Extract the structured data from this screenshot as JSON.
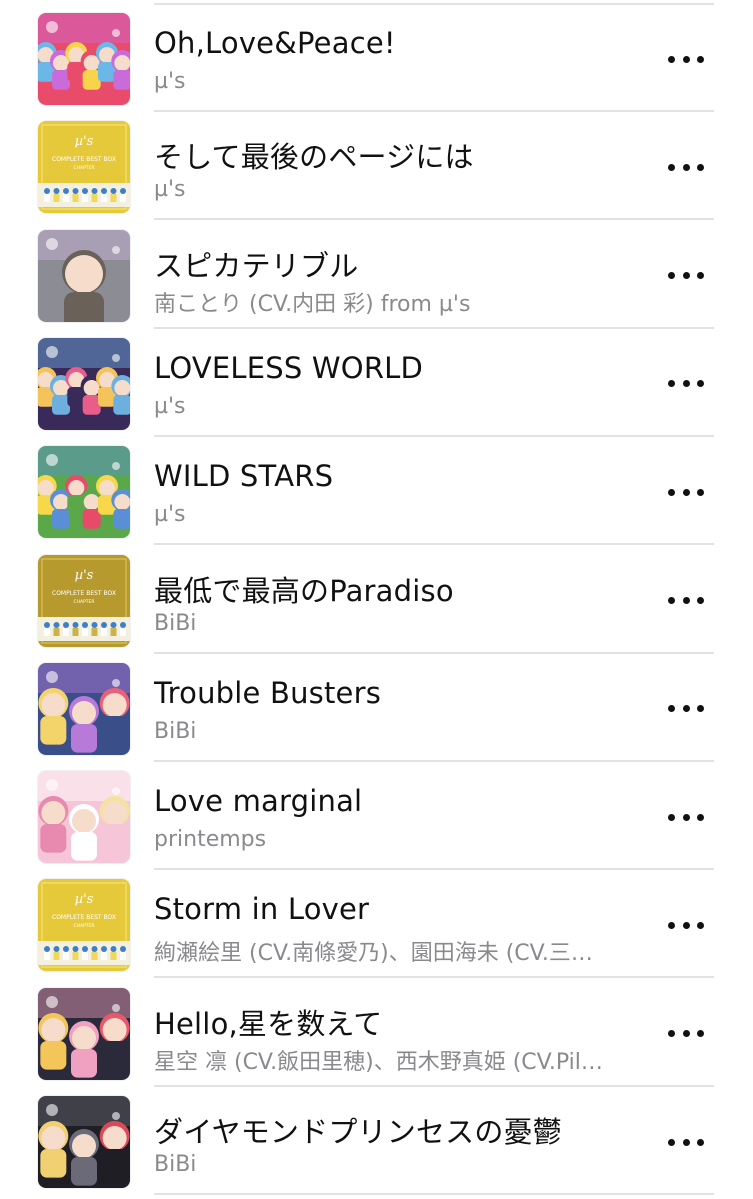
{
  "songs": [
    {
      "title": "Oh,Love&Peace!",
      "artist": "µ's",
      "art": "rainbow-group-icon",
      "art_colors": [
        "#e94b6a",
        "#f7d44a",
        "#6bb7e8",
        "#c96bd8"
      ]
    },
    {
      "title": "そして最後のページには",
      "artist": "µ's",
      "art": "gold-box-icon",
      "art_colors": [
        "#e6c93a",
        "#ffffff",
        "#3d7fc8",
        "#f0d85a"
      ]
    },
    {
      "title": "スピカテリブル",
      "artist": "南ことり (CV.内田 彩) from µ's",
      "art": "portrait-icon",
      "art_colors": [
        "#8c8c95",
        "#f4d9c8",
        "#6a6258",
        "#c9b6d9"
      ]
    },
    {
      "title": "LOVELESS WORLD",
      "artist": "µ's",
      "art": "group-dance-icon",
      "art_colors": [
        "#3a2a5a",
        "#e85d8a",
        "#f4c35a",
        "#6db0e0"
      ]
    },
    {
      "title": "WILD STARS",
      "artist": "µ's",
      "art": "group-circle-icon",
      "art_colors": [
        "#5aa84a",
        "#e84a6a",
        "#f6d84a",
        "#5a8fd8"
      ]
    },
    {
      "title": "最低で最高のParadiso",
      "artist": "BiBi",
      "art": "gold-box-icon",
      "art_colors": [
        "#b79a2e",
        "#ffffff",
        "#3d7fc8",
        "#cdb24a"
      ]
    },
    {
      "title": "Trouble Busters",
      "artist": "BiBi",
      "art": "trio-icon",
      "art_colors": [
        "#3a4e8a",
        "#e8607a",
        "#f2d46a",
        "#b87ad8"
      ]
    },
    {
      "title": "Love marginal",
      "artist": "printemps",
      "art": "trio-pastel-icon",
      "art_colors": [
        "#f6c6d8",
        "#f4e2a2",
        "#e88ab0",
        "#ffffff"
      ]
    },
    {
      "title": "Storm in Lover",
      "artist": "絢瀬絵里 (CV.南條愛乃)、園田海未 (CV.三…",
      "art": "gold-box-icon",
      "art_colors": [
        "#e6c93a",
        "#ffffff",
        "#3d7fc8",
        "#f0d85a"
      ]
    },
    {
      "title": "Hello,星を数えて",
      "artist": "星空 凛 (CV.飯田里穂)、西木野真姫 (CV.Pil…",
      "art": "kimono-trio-icon",
      "art_colors": [
        "#2a2a3a",
        "#e8586a",
        "#f4c65a",
        "#f0a0c0"
      ]
    },
    {
      "title": "ダイヤモンドプリンセスの憂鬱",
      "artist": "BiBi",
      "art": "dark-trio-icon",
      "art_colors": [
        "#1e1e24",
        "#d84a5a",
        "#f0d070",
        "#6a6a78"
      ]
    }
  ],
  "more_icon": "ellipsis-icon"
}
